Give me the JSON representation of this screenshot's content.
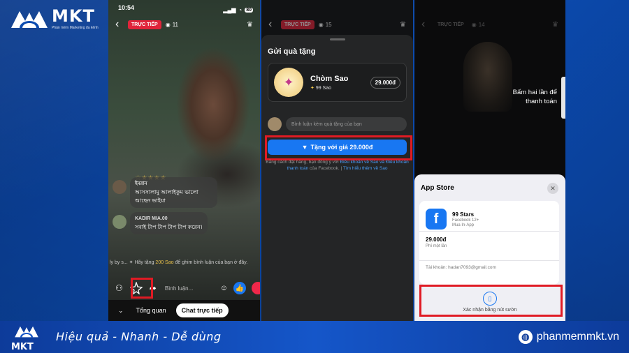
{
  "brand": {
    "logo_word": "MKT",
    "logo_sub": "Phần mềm Marketing đa kênh",
    "slogan": "Hiệu quả - Nhanh  - Dễ dùng",
    "website": "phanmemmkt.vn"
  },
  "live": {
    "time": "10:54",
    "battery": "80",
    "badge": "TRỰC TIẾP",
    "viewers": "11",
    "comments": [
      {
        "name": "ইমরান",
        "text": "আসসালামু আলাইকুম ভালো আছেন ভাইয়া"
      },
      {
        "name": "KADIR MIA.00",
        "text": "সবাই টাপ টাপ টাপ টাপ করেন।"
      }
    ],
    "ticker_prefix": "ly by s...",
    "ticker_before": "Hãy tặng ",
    "ticker_stars": "200 Sao",
    "ticker_after": " để ghim bình luận của bạn ở đây.",
    "comment_placeholder": "Bình luận...",
    "tab_overview": "Tổng quan",
    "tab_chat": "Chat trực tiếp"
  },
  "gift": {
    "badge": "TRỰC TIẾP",
    "viewers": "15",
    "title": "Gửi quà tặng",
    "gift_name": "Chòm Sao",
    "gift_stars": "99 Sao",
    "gift_price": "29.000đ",
    "input_placeholder": "Bình luận kèm quà tặng của bạn",
    "send_label": "Tặng với giá 29.000đ",
    "terms_before": "Bằng cách đặt hàng, bạn đồng ý với ",
    "terms_link1": "Điều khoản về Sao và Điều khoản thanh toán",
    "terms_mid": " của Facebook. | ",
    "terms_link2": "Tìm hiểu thêm về Sao"
  },
  "appstore": {
    "badge": "TRỰC TIẾP",
    "viewers": "14",
    "hint": "Bấm hai lần để thanh toán",
    "title": "App Store",
    "app_name": "99 Stars",
    "app_dev": "Facebook 12+",
    "app_type": "Mua In-App",
    "price": "29.000đ",
    "price_sub": "Phí một lần",
    "account": "Tài khoản: hadan7093@gmail.com",
    "confirm": "Xác nhận bằng nút sườn"
  }
}
